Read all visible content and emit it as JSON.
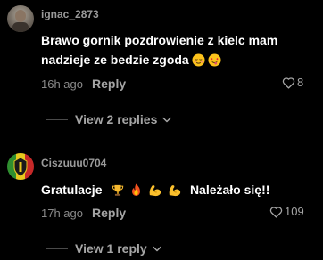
{
  "comments": [
    {
      "username": "ignac_2873",
      "text_line1": "Brawo gornik pozdrowienie z kielc mam",
      "text_line2": "nadzieje ze bedzie zgoda",
      "timestamp": "16h ago",
      "reply_label": "Reply",
      "like_count": "8",
      "view_replies_label": "View 2 replies",
      "emojis": [
        "relieved-face",
        "face-with-tongue-hearts"
      ]
    },
    {
      "username": "Ciszuuu0704",
      "text_before": "Gratulacje",
      "text_after": "Należało się!!",
      "timestamp": "17h ago",
      "reply_label": "Reply",
      "like_count": "109",
      "view_replies_label": "View 1 reply",
      "emojis": [
        "trophy",
        "fire",
        "flexed-biceps",
        "flexed-biceps"
      ]
    }
  ],
  "colors": {
    "background": "#000000",
    "username": "#9a9a9a",
    "text": "#ffffff",
    "muted": "#8a8a8a",
    "action": "#a5a5a5"
  }
}
